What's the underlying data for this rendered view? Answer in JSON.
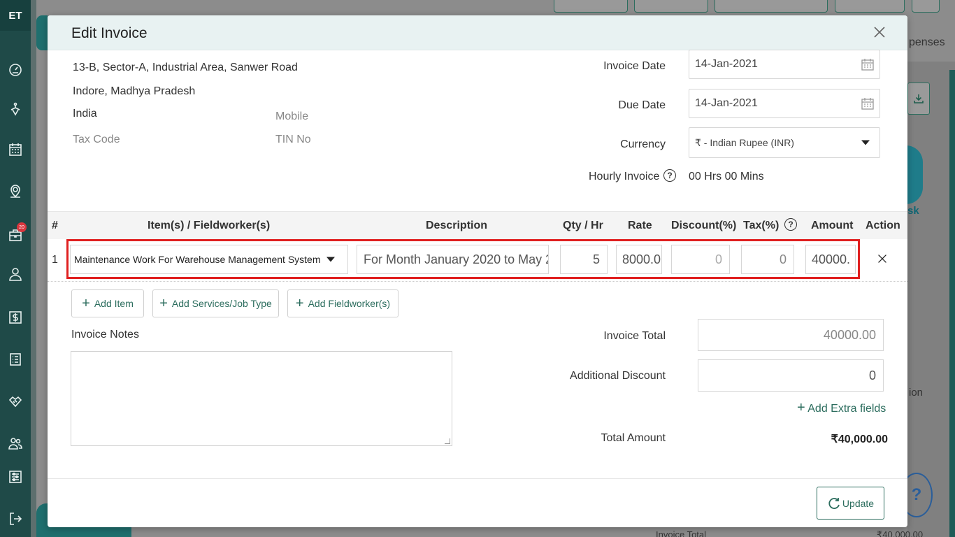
{
  "app": {
    "logo": "ET",
    "badge_count": "20"
  },
  "background": {
    "tab_partial": "penses",
    "task_partial": "sk",
    "column_partial": "ion",
    "help_label": "?",
    "footer_label": "Invoice Total",
    "footer_value": "₹40,000.00"
  },
  "sidebar": {
    "icons": [
      "dashboard-icon",
      "dispatch-icon",
      "calendar-icon",
      "map-pin-icon",
      "jobs-icon",
      "user-icon",
      "billing-icon",
      "list-icon",
      "handshake-icon",
      "team-icon",
      "settings-icon",
      "logout-icon"
    ]
  },
  "modal": {
    "title": "Edit Invoice",
    "address": {
      "line1": "13-B, Sector-A, Industrial Area, Sanwer Road",
      "line2": "Indore, Madhya Pradesh",
      "country": "India",
      "mobile_label": "Mobile",
      "tax_code_label": "Tax Code",
      "tin_label": "TIN No"
    },
    "invoice_date": {
      "label": "Invoice Date",
      "value": "14-Jan-2021"
    },
    "due_date": {
      "label": "Due Date",
      "value": "14-Jan-2021"
    },
    "currency": {
      "label": "Currency",
      "value": "₹ - Indian Rupee (INR)"
    },
    "hourly": {
      "label": "Hourly Invoice",
      "value": "00 Hrs 00 Mins"
    },
    "table": {
      "headers": {
        "num": "#",
        "item": "Item(s) / Fieldworker(s)",
        "description": "Description",
        "qty": "Qty / Hr",
        "rate": "Rate",
        "discount": "Discount(%)",
        "tax": "Tax(%)",
        "amount": "Amount",
        "action": "Action"
      },
      "rows": [
        {
          "num": "1",
          "item": "Maintenance Work For Warehouse Management System",
          "description": "For Month January 2020 to May 2",
          "qty": "5",
          "rate": "8000.0",
          "discount": "0",
          "tax": "0",
          "amount": "40000."
        }
      ]
    },
    "buttons": {
      "add_item": "Add Item",
      "add_services": "Add Services/Job Type",
      "add_fieldworker": "Add Fieldworker(s)",
      "add_extra_fields": "Add Extra fields",
      "update": "Update"
    },
    "notes_label": "Invoice Notes",
    "totals": {
      "invoice_total_label": "Invoice Total",
      "invoice_total_value": "40000.00",
      "additional_discount_label": "Additional Discount",
      "additional_discount_value": "0",
      "total_amount_label": "Total Amount",
      "total_amount_value": "₹40,000.00"
    }
  },
  "colors": {
    "accent": "#2c6d5e",
    "sidebar": "#1f4a48",
    "highlight": "#e02020",
    "header_bg": "#e8f2f2"
  }
}
